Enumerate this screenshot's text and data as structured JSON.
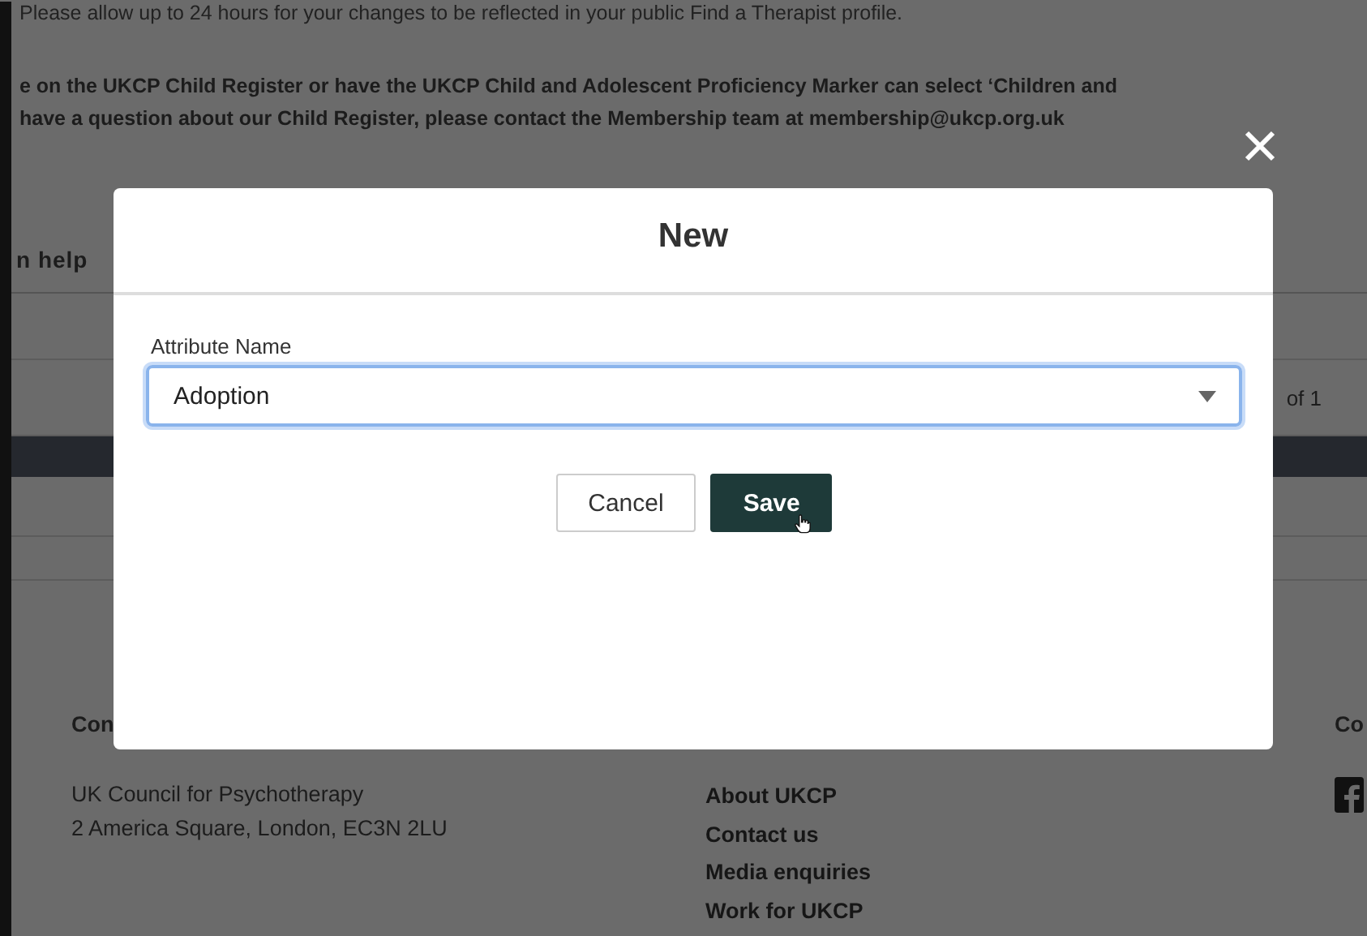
{
  "background_page": {
    "notice_lines": [
      "Please allow up to 24 hours for your changes to be reflected in your public Find a Therapist profile.",
      "e on the UKCP Child Register or have the UKCP Child and Adolescent Proficiency Marker can select ‘Children and",
      "have a question about our Child Register, please contact the Membership team at membership@ukcp.org.uk"
    ],
    "section_tab": "n help",
    "pagination": "of 1",
    "footer": {
      "contact_heading": "Con",
      "address_lines": [
        "UK Council for Psychotherapy",
        "2 America Square, London, EC3N 2LU"
      ],
      "links": [
        "About UKCP",
        "Contact us",
        "Media enquiries",
        "Work for UKCP"
      ],
      "right_heading": "Co"
    }
  },
  "dialog": {
    "title": "New",
    "field": {
      "label": "Attribute Name",
      "value": "Adoption"
    },
    "buttons": [
      {
        "label": "Cancel",
        "kind": "secondary"
      },
      {
        "label": "Save",
        "kind": "primary"
      }
    ]
  }
}
